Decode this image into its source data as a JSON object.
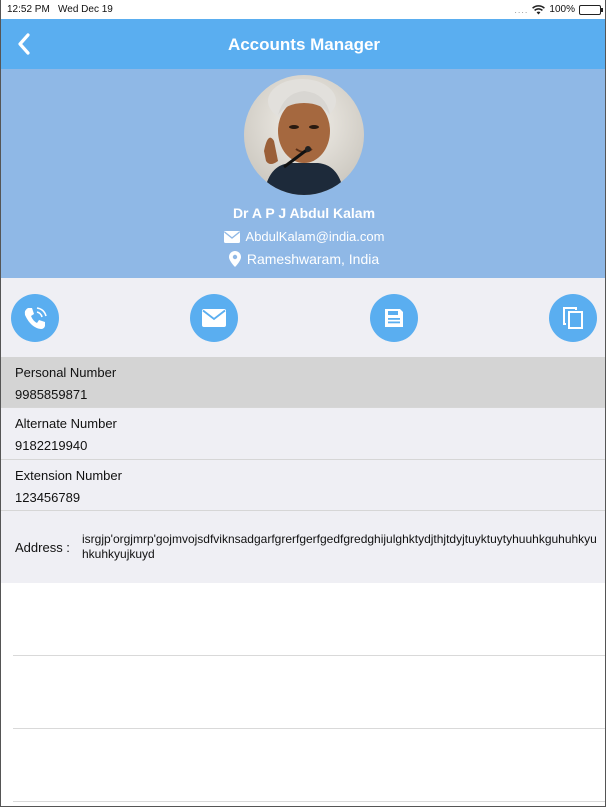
{
  "status_bar": {
    "time": "12:52 PM",
    "date": "Wed Dec 19",
    "battery": "100%"
  },
  "nav": {
    "title": "Accounts Manager",
    "back_icon": "chevron-left-icon"
  },
  "profile": {
    "name": "Dr A P J Abdul Kalam",
    "email": "AbdulKalam@india.com",
    "location": "Rameshwaram, India",
    "email_icon": "envelope-icon",
    "location_icon": "map-pin-icon"
  },
  "actions": [
    {
      "icon": "phone-icon"
    },
    {
      "icon": "mail-icon"
    },
    {
      "icon": "save-icon"
    },
    {
      "icon": "copy-icon"
    }
  ],
  "fields": [
    {
      "label": "Personal Number",
      "value": "9985859871"
    },
    {
      "label": "Alternate Number",
      "value": "9182219940"
    },
    {
      "label": "Extension Number",
      "value": "123456789"
    }
  ],
  "address": {
    "label": "Address :",
    "value": "isrgjp'orgjmrp'gojmvojsdfviknsadgarfgrerfgerfgedfgredghijulghktydjthjtdyjtuyktuytyhuuhkguhuhkyuhkuhkyujkuyd"
  },
  "colors": {
    "nav_background": "#5aaef0",
    "header_background": "#8fb8e6",
    "action_button": "#5aaef0",
    "row_background": "#efeff4",
    "selected_row": "#d4d4d4"
  }
}
